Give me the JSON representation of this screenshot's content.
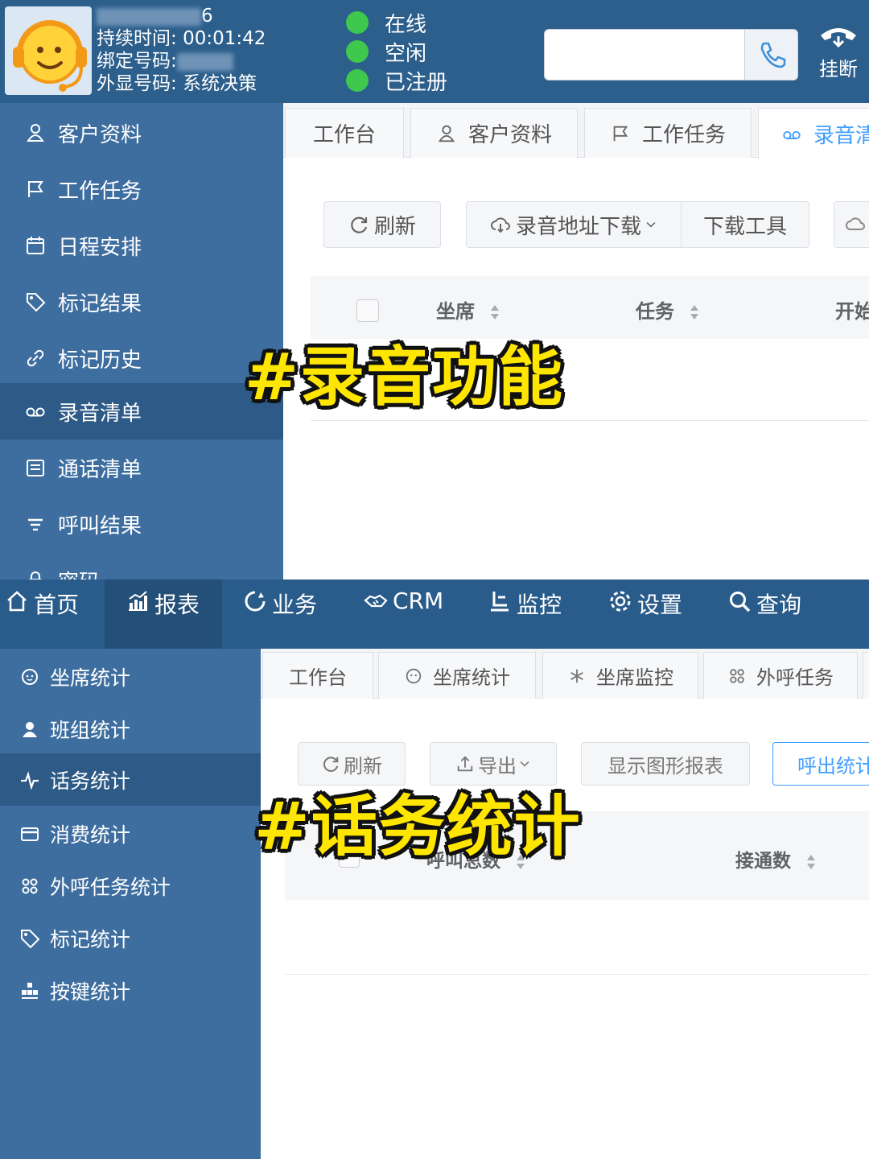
{
  "agent": {
    "id_suffix": "6",
    "duration_label": "持续时间:",
    "duration": "00:01:42",
    "bound_label": "绑定号码:",
    "display_label": "外显号码:",
    "display_value": "系统决策",
    "status": [
      "在线",
      "空闲",
      "已注册"
    ],
    "hangup": "挂断",
    "status_color": "#3ec84e"
  },
  "sidebar1": {
    "items": [
      {
        "label": "客户资料",
        "icon": "user-icon"
      },
      {
        "label": "工作任务",
        "icon": "flag-icon"
      },
      {
        "label": "日程安排",
        "icon": "calendar-icon"
      },
      {
        "label": "标记结果",
        "icon": "tag-icon"
      },
      {
        "label": "标记历史",
        "icon": "link-icon"
      },
      {
        "label": "录音清单",
        "icon": "voicemail-icon"
      },
      {
        "label": "通话清单",
        "icon": "list-icon"
      },
      {
        "label": "呼叫结果",
        "icon": "filter-icon"
      },
      {
        "label": "密码",
        "icon": "lock-icon"
      }
    ],
    "active": "录音清单"
  },
  "tabs1": [
    "工作台",
    "客户资料",
    "工作任务",
    "录音清单"
  ],
  "toolbar1": {
    "refresh": "刷新",
    "download_url": "录音地址下载",
    "download_tool": "下载工具"
  },
  "table1": {
    "columns": [
      "坐席",
      "任务",
      "开始"
    ]
  },
  "overlay1": "#录音功能",
  "topnav": [
    "首页",
    "报表",
    "业务",
    "CRM",
    "监控",
    "设置",
    "查询"
  ],
  "topnav_active": "报表",
  "sidebar2": {
    "items": [
      {
        "label": "坐席统计",
        "icon": "agent-icon"
      },
      {
        "label": "班组统计",
        "icon": "group-icon"
      },
      {
        "label": "话务统计",
        "icon": "pulse-icon"
      },
      {
        "label": "消费统计",
        "icon": "card-icon"
      },
      {
        "label": "外呼任务统计",
        "icon": "grid-icon"
      },
      {
        "label": "标记统计",
        "icon": "tag-icon"
      },
      {
        "label": "按键统计",
        "icon": "keypad-icon"
      }
    ],
    "active": "话务统计"
  },
  "tabs2": [
    "工作台",
    "坐席统计",
    "坐席监控",
    "外呼任务"
  ],
  "toolbar2": {
    "refresh": "刷新",
    "export": "导出",
    "show_chart": "显示图形报表",
    "outbound_stats": "呼出统计"
  },
  "table2": {
    "columns": [
      "呼叫总数",
      "接通数"
    ]
  },
  "overlay2": "#话务统计",
  "colors": {
    "sidebar": "#3e6e9f",
    "header": "#2d5f8c",
    "accent": "#409eff",
    "overlay_text": "#ffe600"
  }
}
